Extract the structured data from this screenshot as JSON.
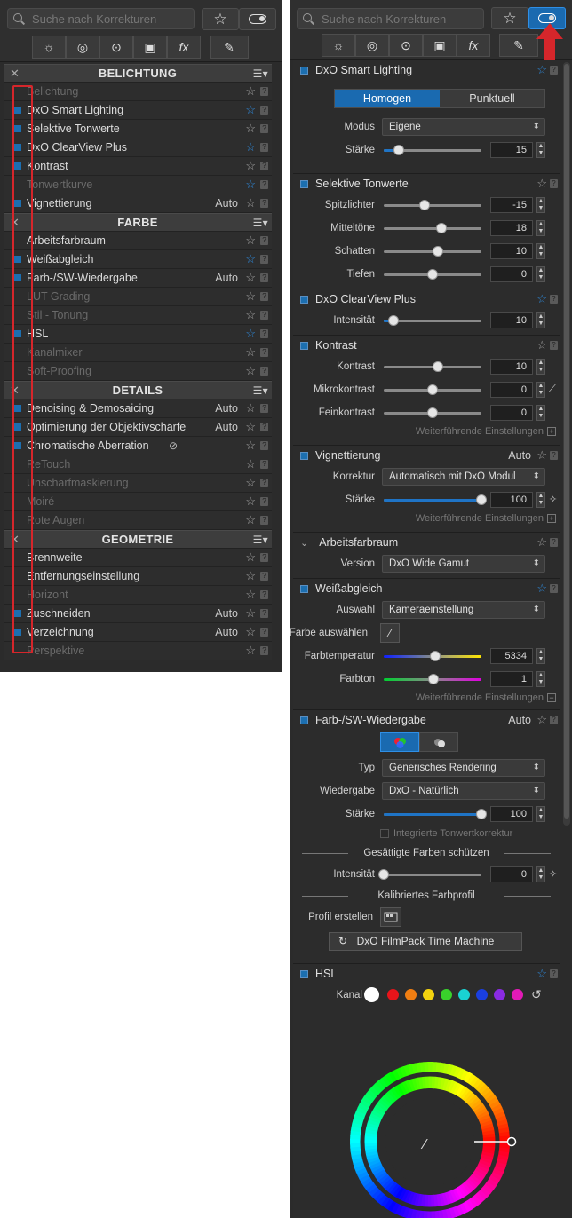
{
  "search": {
    "placeholder": "Suche nach Korrekturen"
  },
  "tabs": [
    "☼",
    "◎",
    "⊙",
    "▣",
    "fx",
    "✎"
  ],
  "left_sections": [
    {
      "title": "BELICHTUNG",
      "items": [
        {
          "label": "Belichtung",
          "checked": false,
          "dim": true,
          "auto": "",
          "star_blue": false
        },
        {
          "label": "DxO Smart Lighting",
          "checked": true,
          "dim": false,
          "auto": "",
          "star_blue": true
        },
        {
          "label": "Selektive Tonwerte",
          "checked": true,
          "dim": false,
          "auto": "",
          "star_blue": false
        },
        {
          "label": "DxO ClearView Plus",
          "checked": true,
          "dim": false,
          "auto": "",
          "star_blue": true
        },
        {
          "label": "Kontrast",
          "checked": true,
          "dim": false,
          "auto": "",
          "star_blue": false
        },
        {
          "label": "Tonwertkurve",
          "checked": false,
          "dim": true,
          "auto": "",
          "star_blue": true
        },
        {
          "label": "Vignettierung",
          "checked": true,
          "dim": false,
          "auto": "Auto",
          "star_blue": false
        }
      ]
    },
    {
      "title": "FARBE",
      "items": [
        {
          "label": "Arbeitsfarbraum",
          "checked": false,
          "dim": false,
          "auto": "",
          "star_blue": false
        },
        {
          "label": "Weißabgleich",
          "checked": true,
          "dim": false,
          "auto": "",
          "star_blue": true
        },
        {
          "label": "Farb-/SW-Wiedergabe",
          "checked": true,
          "dim": false,
          "auto": "Auto",
          "star_blue": false
        },
        {
          "label": "LUT Grading",
          "checked": false,
          "dim": true,
          "auto": "",
          "star_blue": false
        },
        {
          "label": "Stil - Tonung",
          "checked": false,
          "dim": true,
          "auto": "",
          "star_blue": false
        },
        {
          "label": "HSL",
          "checked": true,
          "dim": false,
          "auto": "",
          "star_blue": true
        },
        {
          "label": "Kanalmixer",
          "checked": false,
          "dim": true,
          "auto": "",
          "star_blue": false
        },
        {
          "label": "Soft-Proofing",
          "checked": false,
          "dim": true,
          "auto": "",
          "star_blue": false
        }
      ]
    },
    {
      "title": "DETAILS",
      "items": [
        {
          "label": "Denoising & Demosaicing",
          "checked": true,
          "dim": false,
          "auto": "Auto",
          "star_blue": false
        },
        {
          "label": "Optimierung der Objektivschärfe",
          "checked": true,
          "dim": false,
          "auto": "Auto",
          "star_blue": false
        },
        {
          "label": "Chromatische Aberration",
          "checked": true,
          "dim": false,
          "auto": "",
          "star_blue": false,
          "eye": true
        },
        {
          "label": "ReTouch",
          "checked": false,
          "dim": true,
          "auto": "",
          "star_blue": false
        },
        {
          "label": "Unscharfmaskierung",
          "checked": false,
          "dim": true,
          "auto": "",
          "star_blue": false
        },
        {
          "label": "Moiré",
          "checked": false,
          "dim": true,
          "auto": "",
          "star_blue": false
        },
        {
          "label": "Rote Augen",
          "checked": false,
          "dim": true,
          "auto": "",
          "star_blue": false
        }
      ]
    },
    {
      "title": "GEOMETRIE",
      "items": [
        {
          "label": "Brennweite",
          "checked": false,
          "dim": false,
          "auto": "",
          "star_blue": false
        },
        {
          "label": "Entfernungseinstellung",
          "checked": false,
          "dim": false,
          "auto": "",
          "star_blue": false
        },
        {
          "label": "Horizont",
          "checked": false,
          "dim": true,
          "auto": "",
          "star_blue": false
        },
        {
          "label": "Zuschneiden",
          "checked": true,
          "dim": false,
          "auto": "Auto",
          "star_blue": false
        },
        {
          "label": "Verzeichnung",
          "checked": true,
          "dim": false,
          "auto": "Auto",
          "star_blue": false
        },
        {
          "label": "Perspektive",
          "checked": false,
          "dim": true,
          "auto": "",
          "star_blue": false
        }
      ]
    }
  ],
  "smart_lighting": {
    "title": "DxO Smart Lighting",
    "seg_a": "Homogen",
    "seg_b": "Punktuell",
    "modus_label": "Modus",
    "modus_value": "Eigene",
    "staerke_label": "Stärke",
    "staerke_value": "15",
    "staerke_frac": 0.15
  },
  "selektive": {
    "title": "Selektive Tonwerte",
    "rows": [
      {
        "label": "Spitzlichter",
        "value": "-15",
        "frac": 0.42
      },
      {
        "label": "Mitteltöne",
        "value": "18",
        "frac": 0.59
      },
      {
        "label": "Schatten",
        "value": "10",
        "frac": 0.55
      },
      {
        "label": "Tiefen",
        "value": "0",
        "frac": 0.5
      }
    ]
  },
  "clearview": {
    "title": "DxO ClearView Plus",
    "label": "Intensität",
    "value": "10",
    "frac": 0.1
  },
  "kontrast": {
    "title": "Kontrast",
    "rows": [
      {
        "label": "Kontrast",
        "value": "10",
        "frac": 0.55
      },
      {
        "label": "Mikrokontrast",
        "value": "0",
        "frac": 0.5
      },
      {
        "label": "Feinkontrast",
        "value": "0",
        "frac": 0.5
      }
    ],
    "more": "Weiterführende Einstellungen"
  },
  "vignettierung": {
    "title": "Vignettierung",
    "auto": "Auto",
    "korrektur_label": "Korrektur",
    "korrektur_value": "Automatisch mit DxO Modul",
    "staerke_label": "Stärke",
    "staerke_value": "100",
    "staerke_frac": 1.0,
    "more": "Weiterführende Einstellungen"
  },
  "arbeitsfarbraum": {
    "title": "Arbeitsfarbraum",
    "version_label": "Version",
    "version_value": "DxO Wide Gamut"
  },
  "weissabgleich": {
    "title": "Weißabgleich",
    "auswahl_label": "Auswahl",
    "auswahl_value": "Kameraeinstellung",
    "farbe_label": "Farbe auswählen",
    "temp_label": "Farbtemperatur",
    "temp_value": "5334",
    "temp_frac": 0.53,
    "ton_label": "Farbton",
    "ton_value": "1",
    "ton_frac": 0.51,
    "more": "Weiterführende Einstellungen"
  },
  "farbwiedergabe": {
    "title": "Farb-/SW-Wiedergabe",
    "auto": "Auto",
    "typ_label": "Typ",
    "typ_value": "Generisches Rendering",
    "wied_label": "Wiedergabe",
    "wied_value": "DxO - Natürlich",
    "staerke_label": "Stärke",
    "staerke_value": "100",
    "staerke_frac": 1.0,
    "tonwert_label": "Integrierte Tonwertkorrektur",
    "protect_title": "Gesättigte Farben schützen",
    "int_label": "Intensität",
    "int_value": "0",
    "int_frac": 0.0,
    "profil_title": "Kalibriertes Farbprofil",
    "profil_label": "Profil erstellen",
    "filmpack": "DxO FilmPack Time Machine"
  },
  "hsl": {
    "title": "HSL",
    "kanal_label": "Kanal",
    "dots": [
      "#ffffff",
      "#e8141a",
      "#f07e12",
      "#f3d20f",
      "#39d22b",
      "#19d2d2",
      "#1a3fe0",
      "#8a2be2",
      "#e21ab6"
    ]
  },
  "colors": {
    "accent": "#1a6ab0",
    "red": "#d6262b"
  }
}
